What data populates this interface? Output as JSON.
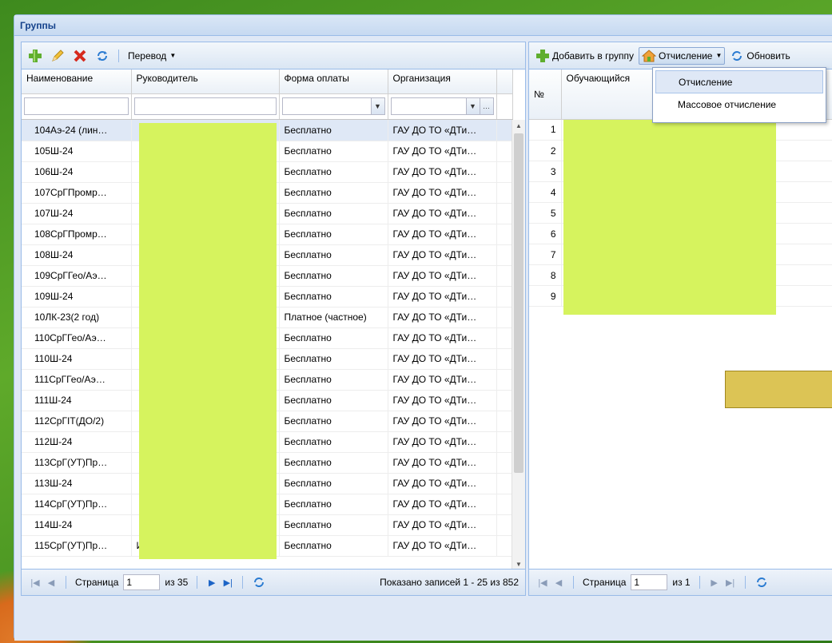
{
  "window": {
    "title": "Группы"
  },
  "left": {
    "toolbar": {
      "perevod_label": "Перевод"
    },
    "columns": [
      "Наименование",
      "Руководитель",
      "Форма оплаты",
      "Организация"
    ],
    "rows": [
      [
        "104Аэ-24 (лин…",
        "",
        "Бесплатно",
        "ГАУ ДО ТО «ДТи…"
      ],
      [
        "105Ш-24",
        "",
        "Бесплатно",
        "ГАУ ДО ТО «ДТи…"
      ],
      [
        "106Ш-24",
        "",
        "Бесплатно",
        "ГАУ ДО ТО «ДТи…"
      ],
      [
        "107СрГПромр…",
        "",
        "Бесплатно",
        "ГАУ ДО ТО «ДТи…"
      ],
      [
        "107Ш-24",
        "",
        "Бесплатно",
        "ГАУ ДО ТО «ДТи…"
      ],
      [
        "108СрГПромр…",
        "",
        "Бесплатно",
        "ГАУ ДО ТО «ДТи…"
      ],
      [
        "108Ш-24",
        "",
        "Бесплатно",
        "ГАУ ДО ТО «ДТи…"
      ],
      [
        "109СрГГео/Аэ…",
        "",
        "Бесплатно",
        "ГАУ ДО ТО «ДТи…"
      ],
      [
        "109Ш-24",
        "",
        "Бесплатно",
        "ГАУ ДО ТО «ДТи…"
      ],
      [
        "10ЛК-23(2 год)",
        "",
        "Платное (частное)",
        "ГАУ ДО ТО «ДТи…"
      ],
      [
        "110СрГГео/Аэ…",
        "",
        "Бесплатно",
        "ГАУ ДО ТО «ДТи…"
      ],
      [
        "110Ш-24",
        "",
        "Бесплатно",
        "ГАУ ДО ТО «ДТи…"
      ],
      [
        "111СрГГео/Аэ…",
        "",
        "Бесплатно",
        "ГАУ ДО ТО «ДТи…"
      ],
      [
        "111Ш-24",
        "",
        "Бесплатно",
        "ГАУ ДО ТО «ДТи…"
      ],
      [
        "112СрГIT(ДО/2)",
        "",
        "Бесплатно",
        "ГАУ ДО ТО «ДТи…"
      ],
      [
        "112Ш-24",
        "",
        "Бесплатно",
        "ГАУ ДО ТО «ДТи…"
      ],
      [
        "113СрГ(УТ)Пр…",
        "",
        "Бесплатно",
        "ГАУ ДО ТО «ДТи…"
      ],
      [
        "113Ш-24",
        "",
        "Бесплатно",
        "ГАУ ДО ТО «ДТи…"
      ],
      [
        "114СрГ(УТ)Пр…",
        "",
        "Бесплатно",
        "ГАУ ДО ТО «ДТи…"
      ],
      [
        "114Ш-24",
        "",
        "Бесплатно",
        "ГАУ ДО ТО «ДТи…"
      ],
      [
        "115СрГ(УТ)Пр…",
        "Исаев Денис Алексеевич",
        "Бесплатно",
        "ГАУ ДО ТО «ДТи…"
      ]
    ],
    "pager": {
      "page_label": "Страница",
      "page_value": "1",
      "of_label": "из 35",
      "summary": "Показано записей 1 - 25 из 852"
    }
  },
  "right": {
    "toolbar": {
      "add_label": "Добавить в группу",
      "expel_label": "Отчисление",
      "refresh_label": "Обновить"
    },
    "columns": [
      "№",
      "Обучающийся"
    ],
    "rows": [
      "1",
      "2",
      "3",
      "4",
      "5",
      "6",
      "7",
      "8",
      "9"
    ],
    "pager": {
      "page_label": "Страница",
      "page_value": "1",
      "of_label": "из 1"
    }
  },
  "dropdown": {
    "items": [
      "Отчисление",
      "Массовое отчисление"
    ]
  },
  "colors": {
    "accent": "#15428b",
    "redaction": "#d6f35e",
    "panel_border": "#99bbe8"
  }
}
